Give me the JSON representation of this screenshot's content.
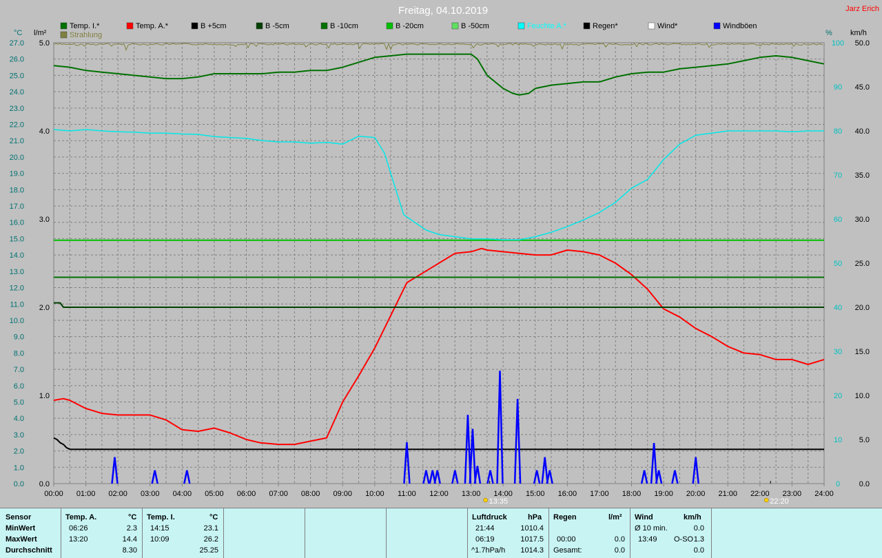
{
  "header": {
    "title": "Freitag, 04.10.2019",
    "author": "Jarz Erich"
  },
  "axes": {
    "left1_unit": "°C",
    "left2_unit": "l/m²",
    "right1_unit": "%",
    "right2_unit": "km/h"
  },
  "legend": [
    {
      "label": "Temp. I.*",
      "color": "#007000"
    },
    {
      "label": "Temp. A.*",
      "color": "#ff0000"
    },
    {
      "label": "B +5cm",
      "color": "#000000"
    },
    {
      "label": "B -5cm",
      "color": "#004000"
    },
    {
      "label": "B -10cm",
      "color": "#007000"
    },
    {
      "label": "B -20cm",
      "color": "#00c000"
    },
    {
      "label": "B -50cm",
      "color": "#60e060"
    },
    {
      "label": "Feuchte A.*",
      "color": "#00ffff"
    },
    {
      "label": "Regen*",
      "color": "#000000"
    },
    {
      "label": "Wind*",
      "color": "#ffffff"
    },
    {
      "label": "Windböen",
      "color": "#0000ff"
    },
    {
      "label": "Strahlung",
      "color": "#808040"
    }
  ],
  "chart_data": {
    "type": "line",
    "x_unit": "hours",
    "xlim": [
      0,
      24
    ],
    "x_ticks": [
      "00:00",
      "01:00",
      "02:00",
      "03:00",
      "04:00",
      "05:00",
      "06:00",
      "07:00",
      "08:00",
      "09:00",
      "10:00",
      "11:00",
      "12:00",
      "13:00",
      "14:00",
      "15:00",
      "16:00",
      "17:00",
      "18:00",
      "19:00",
      "20:00",
      "21:00",
      "22:00",
      "23:00",
      "24:00"
    ],
    "left1": {
      "unit": "°C",
      "ylim": [
        0,
        27
      ],
      "ticks": [
        "0.0",
        "1.0",
        "2.0",
        "3.0",
        "4.0",
        "5.0",
        "6.0",
        "7.0",
        "8.0",
        "9.0",
        "10.0",
        "11.0",
        "12.0",
        "13.0",
        "14.0",
        "15.0",
        "16.0",
        "17.0",
        "18.0",
        "19.0",
        "20.0",
        "21.0",
        "22.0",
        "23.0",
        "24.0",
        "25.0",
        "26.0",
        "27.0"
      ]
    },
    "left2": {
      "unit": "l/m²",
      "ylim": [
        0,
        5
      ],
      "ticks": [
        "0.0",
        "1.0",
        "2.0",
        "3.0",
        "4.0",
        "5.0"
      ]
    },
    "right1": {
      "unit": "%",
      "ylim": [
        0,
        100
      ],
      "ticks": [
        "0",
        "10",
        "20",
        "30",
        "40",
        "50",
        "60",
        "70",
        "80",
        "90",
        "100"
      ]
    },
    "right2": {
      "unit": "km/h",
      "ylim": [
        0,
        50
      ],
      "ticks": [
        "0.0",
        "5.0",
        "10.0",
        "15.0",
        "20.0",
        "25.0",
        "30.0",
        "35.0",
        "40.0",
        "45.0",
        "50.0"
      ]
    },
    "grid": true,
    "annotations": [
      {
        "x": 13.58,
        "label": "13:35"
      },
      {
        "x": 22.33,
        "label": "22:20"
      }
    ],
    "series": [
      {
        "name": "Temp. I.*",
        "axis": "left1",
        "color": "#007000",
        "width": 2,
        "x": [
          0,
          0.5,
          1,
          1.5,
          2,
          2.5,
          3,
          3.5,
          4,
          4.5,
          5,
          5.5,
          6,
          6.5,
          7,
          7.5,
          8,
          8.5,
          9,
          9.5,
          10,
          10.5,
          11,
          11.5,
          12,
          12.5,
          13,
          13.2,
          13.5,
          14,
          14.3,
          14.5,
          14.8,
          15,
          15.5,
          16,
          16.5,
          17,
          17.5,
          18,
          18.5,
          19,
          19.5,
          20,
          20.5,
          21,
          21.5,
          22,
          22.5,
          23,
          23.5,
          24
        ],
        "y": [
          25.6,
          25.5,
          25.3,
          25.2,
          25.1,
          25.0,
          24.9,
          24.8,
          24.8,
          24.9,
          25.1,
          25.1,
          25.1,
          25.1,
          25.2,
          25.2,
          25.3,
          25.3,
          25.5,
          25.8,
          26.1,
          26.2,
          26.3,
          26.3,
          26.3,
          26.3,
          26.3,
          26.0,
          25.0,
          24.2,
          23.9,
          23.8,
          23.9,
          24.2,
          24.4,
          24.5,
          24.6,
          24.6,
          24.9,
          25.1,
          25.2,
          25.2,
          25.4,
          25.5,
          25.6,
          25.7,
          25.9,
          26.1,
          26.2,
          26.1,
          25.9,
          25.7
        ]
      },
      {
        "name": "Temp. A.*",
        "axis": "left1",
        "color": "#ff0000",
        "width": 2,
        "x": [
          0,
          0.3,
          0.5,
          1,
          1.5,
          2,
          2.5,
          3,
          3.5,
          4,
          4.5,
          5,
          5.5,
          6,
          6.43,
          7,
          7.5,
          8,
          8.5,
          9,
          9.5,
          10,
          10.5,
          11,
          11.5,
          12,
          12.5,
          13,
          13.33,
          13.5,
          14,
          14.5,
          15,
          15.5,
          16,
          16.5,
          17,
          17.5,
          18,
          18.5,
          19,
          19.5,
          20,
          20.5,
          21,
          21.5,
          22,
          22.5,
          23,
          23.5,
          24
        ],
        "y": [
          5.1,
          5.2,
          5.1,
          4.6,
          4.3,
          4.2,
          4.2,
          4.2,
          3.9,
          3.3,
          3.2,
          3.4,
          3.1,
          2.7,
          2.5,
          2.4,
          2.4,
          2.6,
          2.8,
          5.0,
          6.6,
          8.3,
          10.3,
          12.3,
          12.9,
          13.5,
          14.1,
          14.2,
          14.4,
          14.3,
          14.2,
          14.1,
          14.0,
          14.0,
          14.3,
          14.2,
          14.0,
          13.5,
          12.8,
          11.9,
          10.7,
          10.2,
          9.5,
          9.0,
          8.4,
          8.0,
          7.9,
          7.6,
          7.6,
          7.3,
          7.6
        ]
      },
      {
        "name": "B +5cm",
        "axis": "left1",
        "color": "#000000",
        "width": 2,
        "x": [
          0,
          0.1,
          0.2,
          0.3,
          0.4,
          0.5,
          24
        ],
        "y": [
          2.8,
          2.7,
          2.5,
          2.4,
          2.2,
          2.1,
          2.1
        ]
      },
      {
        "name": "B -5cm",
        "axis": "left2",
        "color": "#004000",
        "width": 2,
        "x": [
          0,
          0.2,
          0.3,
          24
        ],
        "y": [
          2.05,
          2.05,
          2.0,
          2.0
        ]
      },
      {
        "name": "B -10cm",
        "axis": "left2",
        "color": "#007000",
        "width": 2,
        "x": [
          0,
          24
        ],
        "y": [
          2.34,
          2.34
        ]
      },
      {
        "name": "B -20cm",
        "axis": "left2",
        "color": "#00c000",
        "width": 2,
        "x": [
          0,
          24
        ],
        "y": [
          2.76,
          2.76
        ]
      },
      {
        "name": "Feuchte A.*",
        "axis": "right1",
        "color": "#00e8e8",
        "width": 1.5,
        "x": [
          0,
          0.5,
          1,
          1.5,
          2,
          2.5,
          3,
          3.5,
          4,
          4.5,
          5,
          5.5,
          6,
          6.5,
          7,
          7.5,
          8,
          8.5,
          9,
          9.5,
          10,
          10.3,
          10.6,
          10.9,
          11.2,
          11.6,
          12,
          12.5,
          13,
          13.5,
          14,
          14.5,
          15,
          15.5,
          16,
          16.5,
          17,
          17.5,
          18,
          18.5,
          19,
          19.5,
          20,
          20.5,
          21,
          21.5,
          22,
          22.5,
          23,
          23.5,
          24
        ],
        "y": [
          80.3,
          80.0,
          80.3,
          80.0,
          79.8,
          79.7,
          79.5,
          79.5,
          79.3,
          79.2,
          78.7,
          78.5,
          78.3,
          77.8,
          77.5,
          77.5,
          77.2,
          77.4,
          77.0,
          78.8,
          78.5,
          75.0,
          68.0,
          61.0,
          59.5,
          57.5,
          56.5,
          56.0,
          55.5,
          55.5,
          55.3,
          55.3,
          56.0,
          57.0,
          58.3,
          59.8,
          61.5,
          63.8,
          67.0,
          69.0,
          73.5,
          77.0,
          79.0,
          79.5,
          80.0,
          80.0,
          80.0,
          80.0,
          79.8,
          80.0,
          80.0
        ]
      },
      {
        "name": "Windböen",
        "axis": "right2",
        "color": "#0000ff",
        "width": 2.5,
        "type": "spikes",
        "x": [
          1.9,
          3.15,
          4.15,
          11.0,
          11.6,
          11.8,
          11.95,
          12.5,
          12.9,
          13.05,
          13.2,
          13.6,
          13.9,
          14.45,
          15.05,
          15.3,
          15.45,
          18.4,
          18.7,
          18.85,
          19.35,
          20.0
        ],
        "y": [
          3.0,
          1.5,
          1.5,
          4.7,
          1.5,
          1.5,
          1.5,
          1.5,
          7.8,
          6.2,
          2.0,
          1.5,
          12.8,
          9.6,
          1.5,
          3.0,
          1.5,
          1.5,
          4.6,
          1.5,
          1.5,
          3.0
        ]
      },
      {
        "name": "Strahlung",
        "axis": "right1",
        "color": "#808040",
        "width": 1,
        "type": "noisy_top",
        "x": [
          0,
          24
        ],
        "y": [
          99.0,
          99.0
        ]
      }
    ]
  },
  "summary": {
    "sensor": {
      "header": "Sensor",
      "rows": [
        "MinWert",
        "MaxWert",
        "Durchschnitt"
      ]
    },
    "temp_a": {
      "header": "Temp. A.",
      "unit": "°C",
      "min_time": "06:26",
      "min_val": "2.3",
      "max_time": "13:20",
      "max_val": "14.4",
      "avg": "8.30"
    },
    "temp_i": {
      "header": "Temp. I.",
      "unit": "°C",
      "min_time": "14:15",
      "min_val": "23.1",
      "max_time": "10:09",
      "max_val": "26.2",
      "avg": "25.25"
    },
    "luftdruck": {
      "header": "Luftdruck",
      "unit": "hPa",
      "r1_time": "21:44",
      "r1_val": "1010.4",
      "r2_time": "06:19",
      "r2_val": "1017.5",
      "r3_time": "^1.7hPa/h",
      "r3_val": "1014.3"
    },
    "regen": {
      "header": "Regen",
      "unit": "l/m²",
      "r2_time": "00:00",
      "r2_val": "0.0",
      "r3_label": "Gesamt:",
      "r3_val": "0.0"
    },
    "wind": {
      "header": "Wind",
      "unit": "km/h",
      "r1_label": "Ø 10 min.",
      "r1_val": "0.0",
      "r2_time": "13:49",
      "r2_dir": "O-SO",
      "r2_val": "1.3",
      "r3_val": "0.0"
    }
  }
}
